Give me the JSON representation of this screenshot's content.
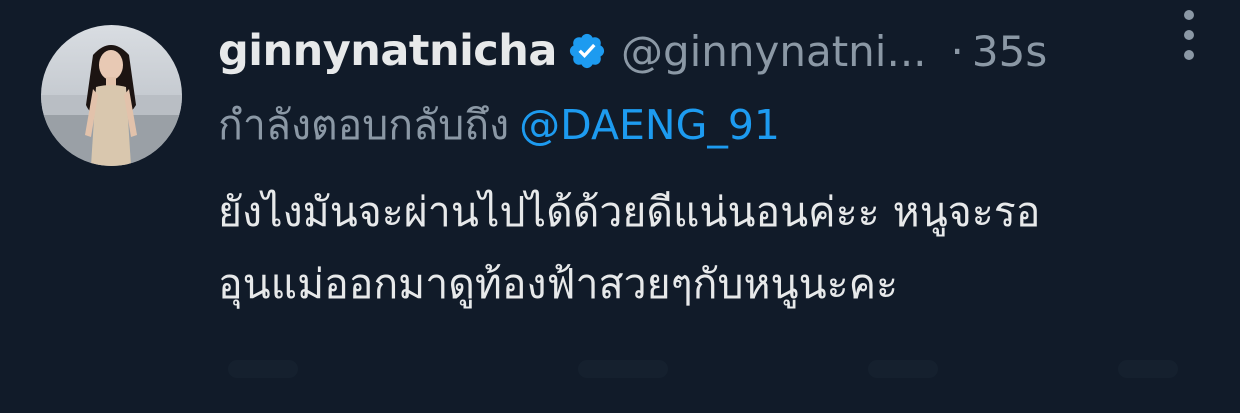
{
  "tweet": {
    "display_name": "ginnynatnicha",
    "handle": "@ginnynatni...",
    "separator": "·",
    "timestamp": "35s",
    "reply_label": "กำลังตอบกลับถึง",
    "reply_mention": "@DAENG_91",
    "body_lines": [
      "ยังไงมันจะผ่านไปได้ด้วยดีแน่นอนค่ะะ หนูจะรอ",
      "อุนแม่ออกมาดูท้องฟ้าสวยๆกับหนูนะคะ"
    ]
  },
  "icons": {
    "verified": "verified-badge-icon",
    "more": "more-options-icon"
  },
  "colors": {
    "background": "#111b29",
    "primary_text": "#e7e9ea",
    "secondary_text": "#8b98a5",
    "accent": "#1d9bf0"
  }
}
